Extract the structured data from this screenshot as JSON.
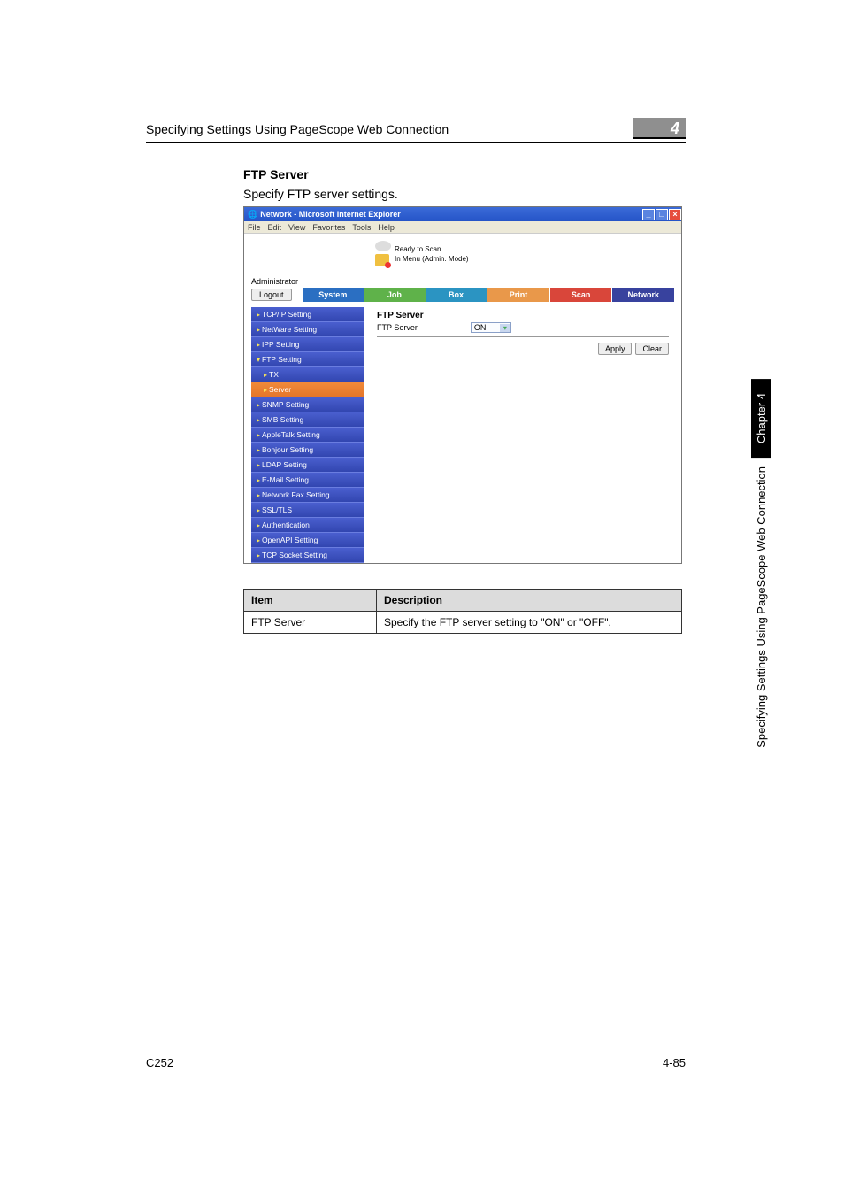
{
  "header": {
    "title": "Specifying Settings Using PageScope Web Connection",
    "chapter_num": "4"
  },
  "section": {
    "title": "FTP Server",
    "description": "Specify FTP server settings."
  },
  "screenshot": {
    "window_title": "Network - Microsoft Internet Explorer",
    "menubar": [
      "File",
      "Edit",
      "View",
      "Favorites",
      "Tools",
      "Help"
    ],
    "status1": "Ready to Scan",
    "status2": "In Menu (Admin. Mode)",
    "role": "Administrator",
    "logout": "Logout",
    "tabs": {
      "system": "System",
      "job": "Job",
      "box": "Box",
      "print": "Print",
      "scan": "Scan",
      "network": "Network"
    },
    "sidebar": [
      {
        "label": "TCP/IP Setting"
      },
      {
        "label": "NetWare Setting"
      },
      {
        "label": "IPP Setting"
      },
      {
        "label": "FTP Setting",
        "expanded": true
      },
      {
        "label": "TX",
        "sub": true
      },
      {
        "label": "Server",
        "sub": true,
        "selected": true
      },
      {
        "label": "SNMP Setting"
      },
      {
        "label": "SMB Setting"
      },
      {
        "label": "AppleTalk Setting"
      },
      {
        "label": "Bonjour Setting"
      },
      {
        "label": "LDAP Setting"
      },
      {
        "label": "E-Mail Setting"
      },
      {
        "label": "Network Fax Setting"
      },
      {
        "label": "SSL/TLS"
      },
      {
        "label": "Authentication"
      },
      {
        "label": "OpenAPI Setting"
      },
      {
        "label": "TCP Socket Setting"
      }
    ],
    "main": {
      "heading": "FTP Server",
      "field_label": "FTP Server",
      "field_value": "ON",
      "apply": "Apply",
      "clear": "Clear"
    }
  },
  "desc_table": {
    "head_item": "Item",
    "head_desc": "Description",
    "rows": [
      {
        "item": "FTP Server",
        "desc": "Specify the FTP server setting to \"ON\" or \"OFF\"."
      }
    ]
  },
  "side_tab": {
    "black": "Chapter 4",
    "plain": "Specifying Settings Using PageScope Web Connection"
  },
  "footer": {
    "left": "C252",
    "right": "4-85"
  }
}
